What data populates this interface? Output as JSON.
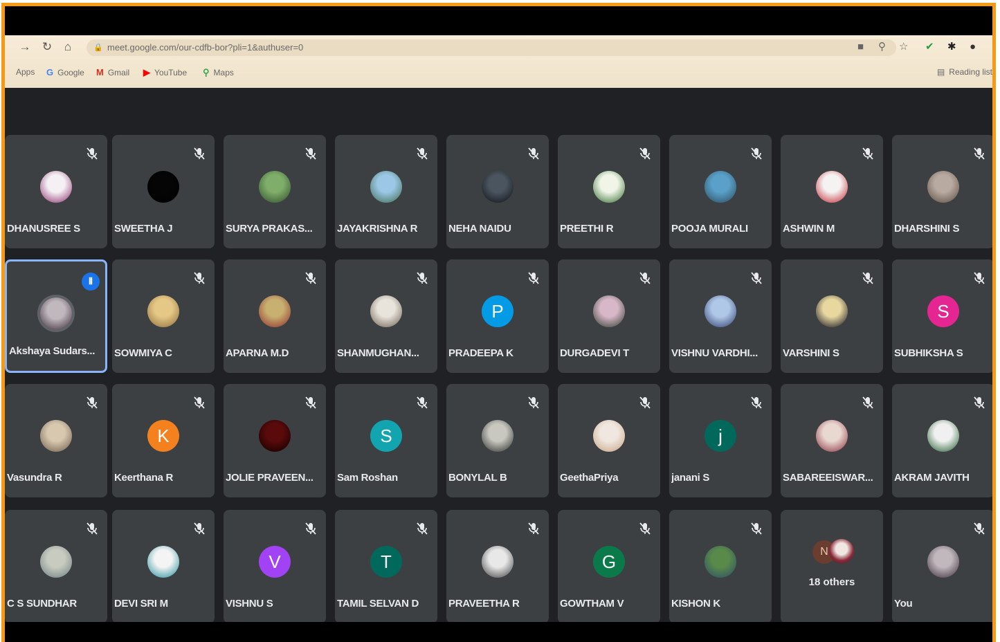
{
  "browser": {
    "url": "meet.google.com/our-cdfb-bor?pli=1&authuser=0",
    "bookmarks": [
      {
        "icon": "apps-icon",
        "label": "Apps",
        "glyph": "",
        "color": "#666666"
      },
      {
        "icon": "google-icon",
        "label": "Google",
        "glyph": "G",
        "color": "#4285f4"
      },
      {
        "icon": "gmail-icon",
        "label": "Gmail",
        "glyph": "M",
        "color": "#d93025"
      },
      {
        "icon": "youtube-icon",
        "label": "YouTube",
        "glyph": "▶",
        "color": "#ff0000"
      },
      {
        "icon": "maps-icon",
        "label": "Maps",
        "glyph": "⚲",
        "color": "#34a853"
      }
    ],
    "reading_list": "Reading list"
  },
  "meet": {
    "participants": [
      {
        "name": "DHANUSREE S",
        "avatar_type": "photo",
        "colors": [
          "#f4f0f4",
          "#8a2a6a"
        ]
      },
      {
        "name": "SWEETHA J",
        "avatar_type": "photo",
        "colors": [
          "#050505",
          "#000000"
        ]
      },
      {
        "name": "SURYA PRAKAS...",
        "avatar_type": "photo",
        "colors": [
          "#7fae6a",
          "#2d4a2a"
        ]
      },
      {
        "name": "JAYAKRISHNA R",
        "avatar_type": "photo",
        "colors": [
          "#9cc7e6",
          "#3a6a4a"
        ]
      },
      {
        "name": "NEHA NAIDU",
        "avatar_type": "photo",
        "colors": [
          "#4a5560",
          "#0d0f12"
        ]
      },
      {
        "name": "PREETHI R",
        "avatar_type": "photo",
        "colors": [
          "#f0f5e8",
          "#2d6a2a"
        ]
      },
      {
        "name": "POOJA MURALI",
        "avatar_type": "photo",
        "colors": [
          "#5aa0c8",
          "#2a4a5a"
        ]
      },
      {
        "name": "ASHWIN M",
        "avatar_type": "photo",
        "colors": [
          "#f5f2f2",
          "#c0202a"
        ]
      },
      {
        "name": "DHARSHINI S",
        "avatar_type": "photo",
        "colors": [
          "#b8aaa0",
          "#5a4a40"
        ]
      },
      {
        "name": "Akshaya Sudars...",
        "avatar_type": "photo",
        "colors": [
          "#c0b8bc",
          "#3a2a3a"
        ],
        "speaking": true
      },
      {
        "name": "SOWMIYA C",
        "avatar_type": "photo",
        "colors": [
          "#e6c886",
          "#8a6a3a"
        ]
      },
      {
        "name": "APARNA M.D",
        "avatar_type": "photo",
        "colors": [
          "#c8b070",
          "#8a2a2a"
        ]
      },
      {
        "name": "SHANMUGHAN...",
        "avatar_type": "photo",
        "colors": [
          "#e8e4dc",
          "#6a5a4a"
        ]
      },
      {
        "name": "PRADEEPA K",
        "avatar_type": "letter",
        "letter": "P",
        "colors": [
          "#039be5",
          "#039be5"
        ]
      },
      {
        "name": "DURGADEVI T",
        "avatar_type": "photo",
        "colors": [
          "#d8b8c8",
          "#2a3a2a"
        ]
      },
      {
        "name": "VISHNU VARDHI...",
        "avatar_type": "photo",
        "colors": [
          "#b0c8e8",
          "#2a3a6a"
        ]
      },
      {
        "name": "VARSHINI S",
        "avatar_type": "photo",
        "colors": [
          "#e8d8a0",
          "#0a0a1a"
        ]
      },
      {
        "name": "SUBHIKSHA S",
        "avatar_type": "letter",
        "letter": "S",
        "colors": [
          "#e52592",
          "#e52592"
        ]
      },
      {
        "name": "Vasundra R",
        "avatar_type": "photo",
        "colors": [
          "#d8c8b0",
          "#6a5a48"
        ]
      },
      {
        "name": "Keerthana R",
        "avatar_type": "letter",
        "letter": "K",
        "colors": [
          "#f4811e",
          "#f4811e"
        ]
      },
      {
        "name": "JOLIE PRAVEEN...",
        "avatar_type": "photo",
        "colors": [
          "#5a0a0a",
          "#0a0000"
        ]
      },
      {
        "name": "Sam Roshan",
        "avatar_type": "letter",
        "letter": "S",
        "colors": [
          "#12a4af",
          "#12a4af"
        ]
      },
      {
        "name": "BONYLAL B",
        "avatar_type": "photo",
        "colors": [
          "#c8c8c0",
          "#2a2a28"
        ]
      },
      {
        "name": "GeethaPriya",
        "avatar_type": "photo",
        "colors": [
          "#f0e8e0",
          "#c8a080"
        ]
      },
      {
        "name": "janani S",
        "avatar_type": "letter",
        "letter": "j",
        "colors": [
          "#00695c",
          "#00695c"
        ]
      },
      {
        "name": "SABAREEISWAR...",
        "avatar_type": "photo",
        "colors": [
          "#e8d8d0",
          "#8a2a3a"
        ]
      },
      {
        "name": "AKRAM JAVITH",
        "avatar_type": "photo",
        "colors": [
          "#f0f0f0",
          "#1a5a2a"
        ]
      },
      {
        "name": "C S SUNDHAR",
        "avatar_type": "photo",
        "colors": [
          "#c8ccc0",
          "#6a7a80"
        ]
      },
      {
        "name": "DEVI SRI M",
        "avatar_type": "photo",
        "colors": [
          "#f4f4f4",
          "#1a8a9a"
        ]
      },
      {
        "name": "VISHNU S",
        "avatar_type": "letter",
        "letter": "V",
        "colors": [
          "#a142f4",
          "#a142f4"
        ]
      },
      {
        "name": "TAMIL SELVAN D",
        "avatar_type": "letter",
        "letter": "T",
        "colors": [
          "#00695c",
          "#00695c"
        ]
      },
      {
        "name": "PRAVEETHA R",
        "avatar_type": "photo",
        "colors": [
          "#e8e8e8",
          "#3a3a3a"
        ]
      },
      {
        "name": "GOWTHAM V",
        "avatar_type": "letter",
        "letter": "G",
        "colors": [
          "#0b7a4a",
          "#0b7a4a"
        ]
      },
      {
        "name": "KISHON K",
        "avatar_type": "photo",
        "colors": [
          "#5a8a4a",
          "#2a4a6a"
        ]
      },
      {
        "name": "",
        "avatar_type": "others",
        "others_label": "18 others",
        "letter": "N"
      },
      {
        "name": "You",
        "avatar_type": "photo",
        "colors": [
          "#c0b8bc",
          "#3a2a3a"
        ]
      }
    ]
  }
}
